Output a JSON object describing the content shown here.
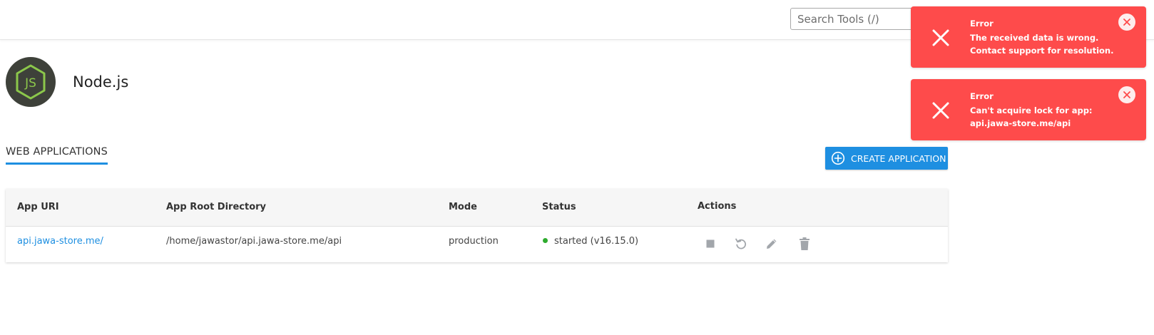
{
  "search": {
    "placeholder": "Search Tools (/)"
  },
  "app": {
    "title": "Node.js",
    "logo_text": "JS"
  },
  "tabs": [
    {
      "label": "WEB APPLICATIONS",
      "active": true
    }
  ],
  "create_button": {
    "label": "CREATE APPLICATION"
  },
  "table": {
    "headers": [
      "App URI",
      "App Root Directory",
      "Mode",
      "Status",
      "Actions"
    ],
    "rows": [
      {
        "uri": "api.jawa-store.me/",
        "root": "/home/jawastor/api.jawa-store.me/api",
        "mode": "production",
        "status": "started (v16.15.0)"
      }
    ],
    "actions": [
      "stop-icon",
      "restart-icon",
      "edit-icon",
      "delete-icon"
    ]
  },
  "toasts": [
    {
      "title": "Error",
      "message": "The received data is wrong. Contact support for resolution."
    },
    {
      "title": "Error",
      "message": "Can't acquire lock for app: api.jawa-store.me/api"
    }
  ],
  "colors": {
    "accent": "#1e8fe1",
    "error": "#fe4b4b",
    "status_ok": "#2eab2e",
    "logo_bg": "#3e413a",
    "logo_green": "#8cc84b"
  }
}
